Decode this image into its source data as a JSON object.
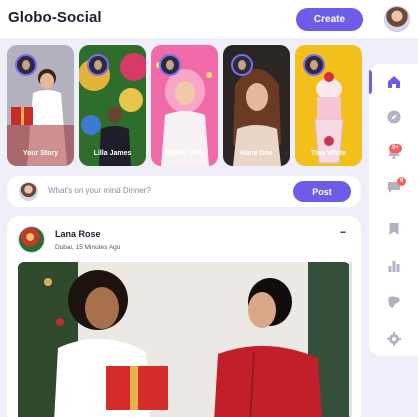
{
  "header": {
    "logo": "Globo-Social",
    "create_label": "Create"
  },
  "stories": [
    {
      "name": "Your Story"
    },
    {
      "name": "Lilla James"
    },
    {
      "name": "Daniel Bale"
    },
    {
      "name": "Hane Doe"
    },
    {
      "name": "Tina White"
    }
  ],
  "composer": {
    "placeholder": "What's on your mind Dinner?",
    "post_label": "Post"
  },
  "post": {
    "author": "Lana Rose",
    "meta": "Dubai, 15 Minutes Ago",
    "more": "..."
  },
  "sidebar": {
    "items": [
      {
        "icon": "home-icon",
        "active": true
      },
      {
        "icon": "compass-icon"
      },
      {
        "icon": "notification-bell-icon",
        "badge": "9+"
      },
      {
        "icon": "message-icon",
        "badge": "6"
      },
      {
        "icon": "bookmark-icon"
      },
      {
        "icon": "analytics-icon"
      },
      {
        "icon": "theme-palette-icon"
      },
      {
        "icon": "settings-gear-icon"
      }
    ]
  },
  "colors": {
    "accent": "#6c5ce7",
    "background": "#efeef9",
    "badge": "#ff5b5b"
  }
}
